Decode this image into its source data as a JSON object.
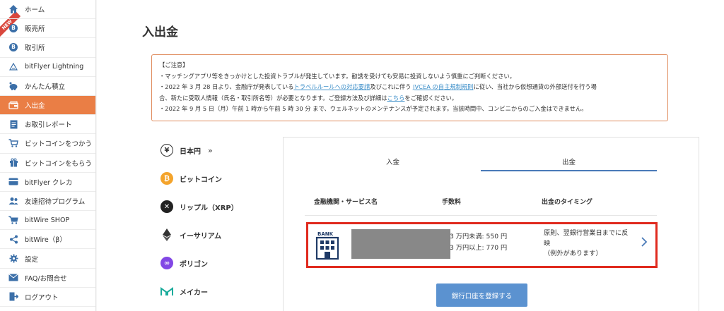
{
  "sidebar": {
    "new_badge": "NEW",
    "items": [
      {
        "label": "ホーム",
        "icon": "home-icon"
      },
      {
        "label": "販売所",
        "icon": "bitcoin-circle-icon"
      },
      {
        "label": "取引所",
        "icon": "bitcoin-circle-icon"
      },
      {
        "label": "bitFlyer Lightning",
        "icon": "lightning-icon"
      },
      {
        "label": "かんたん積立",
        "icon": "piggy-bank-icon"
      },
      {
        "label": "入出金",
        "icon": "wallet-icon",
        "active": true
      },
      {
        "label": "お取引レポート",
        "icon": "report-icon"
      },
      {
        "label": "ビットコインをつかう",
        "icon": "cart-icon"
      },
      {
        "label": "ビットコインをもらう",
        "icon": "gift-icon"
      },
      {
        "label": "bitFlyer クレカ",
        "icon": "credit-card-icon"
      },
      {
        "label": "友達招待プログラム",
        "icon": "invite-friends-icon"
      },
      {
        "label": "bitWire SHOP",
        "icon": "shop-cart-icon"
      },
      {
        "label": "bitWire（β）",
        "icon": "share-icon"
      },
      {
        "label": "設定",
        "icon": "gear-icon"
      },
      {
        "label": "FAQ/お問合せ",
        "icon": "mail-icon"
      },
      {
        "label": "ログアウト",
        "icon": "logout-icon"
      }
    ]
  },
  "page": {
    "title": "入出金"
  },
  "notice": {
    "heading": "【ご注意】",
    "line1": "・マッチングアプリ等をきっかけとした投資トラブルが発生しています。勧誘を受けても安易に投資しないよう慎重にご判断ください。",
    "line2_a": "・2022 年 3 月 28 日より、金融庁が発表している",
    "line2_link1": "トラベルルールへの対応要請",
    "line2_b": "及びこれに伴う ",
    "line2_link2": "JVCEA の自主規制規則",
    "line2_c": "に従い、当社から仮想通貨の外部送付を行う場",
    "line3_a": "合、新たに受取人情報（氏名・取引所名等）が必要となります。ご登録方法及び詳細は",
    "line3_link": "こちら",
    "line3_b": "をご確認ください。",
    "line4": "・2022 年 9 月 5 日（月）午前 1 時から午前 5 時 30 分 まで、ウェルネットのメンテナンスが予定されます。当該時間中、コンビニからのご入金はできません。"
  },
  "currencies": [
    {
      "label": "日本円",
      "icon": "yen-icon",
      "glyph": "¥",
      "selected": true
    },
    {
      "label": "ビットコイン",
      "icon": "bitcoin-icon",
      "glyph": "₿"
    },
    {
      "label": "リップル（XRP）",
      "icon": "xrp-icon",
      "glyph": "✕"
    },
    {
      "label": "イーサリアム",
      "icon": "ethereum-icon",
      "glyph": "◆"
    },
    {
      "label": "ポリゴン",
      "icon": "polygon-icon",
      "glyph": "∞"
    },
    {
      "label": "メイカー",
      "icon": "maker-icon",
      "glyph": "M"
    }
  ],
  "panel": {
    "tabs": [
      {
        "label": "入金",
        "active": false
      },
      {
        "label": "出金",
        "active": true
      }
    ],
    "columns": {
      "institution": "金融機関・サービス名",
      "fee": "手数料",
      "timing": "出金のタイミング"
    },
    "bank_row": {
      "icon_label": "BANK",
      "fee_line1": "3 万円未満: 550 円",
      "fee_line2": "3 万円以上: 770 円",
      "timing_line1": "原則、翌銀行営業日までに反",
      "timing_line2": "映",
      "timing_line3": "（例外があります）"
    },
    "register_button": "銀行口座を登録する"
  },
  "colors": {
    "accent": "#ea7e45",
    "tab_underline": "#4a7ab8",
    "button": "#5b92d0",
    "highlight_border": "#e02a1e",
    "link": "#3d8fc9"
  }
}
